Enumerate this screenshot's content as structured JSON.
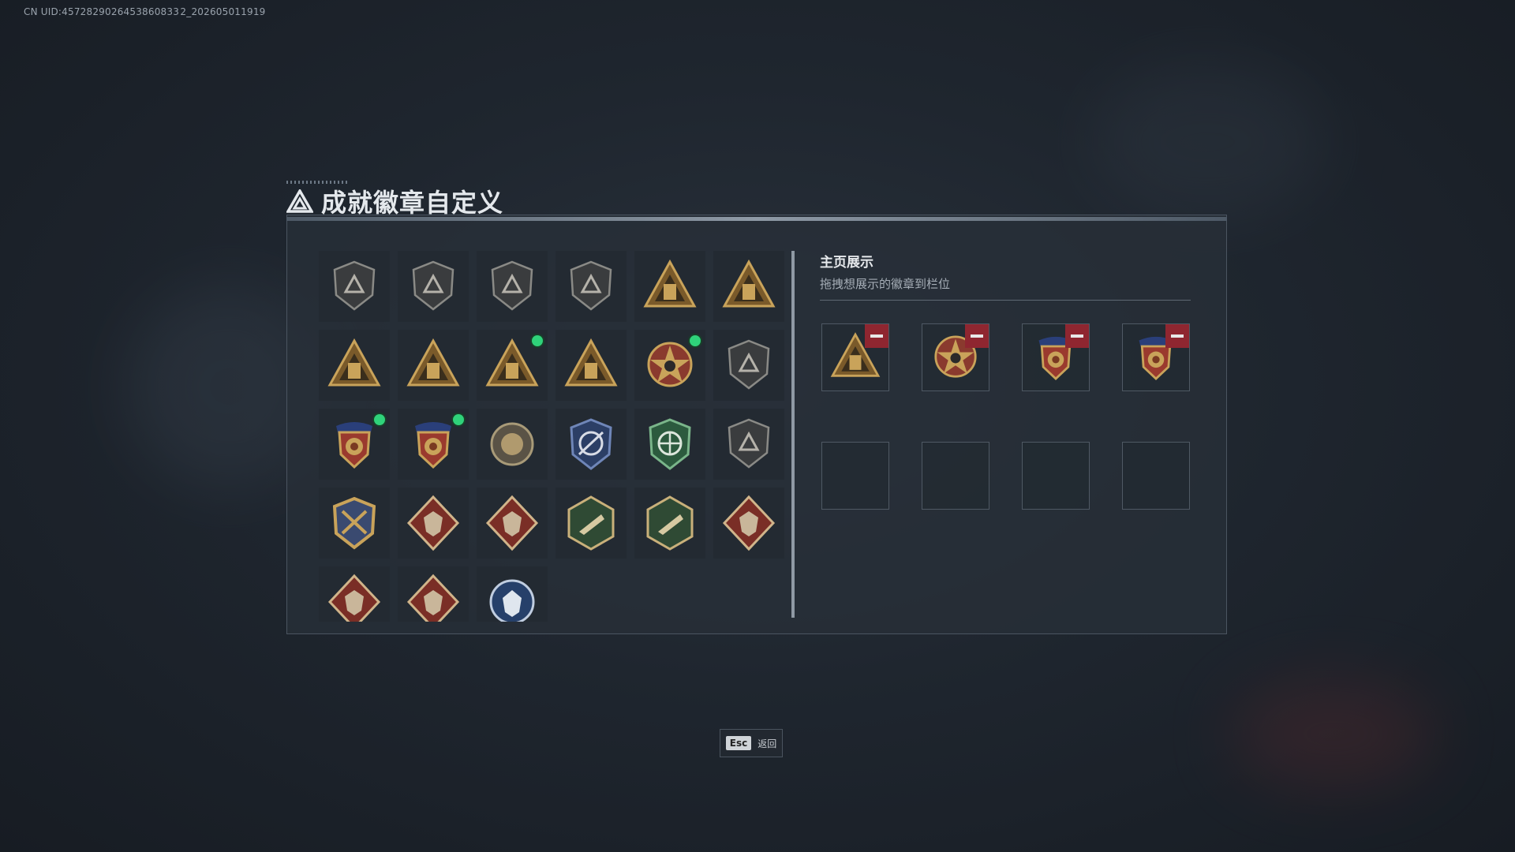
{
  "uid_text": "CN UID:4572829026453860833 2_202605011919",
  "title": "成就徽章自定义",
  "right": {
    "title": "主页展示",
    "subtitle": "拖拽想展示的徽章到栏位"
  },
  "esc": {
    "key": "Esc",
    "label": "返回"
  },
  "badges": [
    {
      "icon": "triangle-shield-badge-icon",
      "style": "dark",
      "new": false
    },
    {
      "icon": "helicopter-shield-badge-icon",
      "style": "dark",
      "new": false
    },
    {
      "icon": "diamond-shield-badge-icon",
      "style": "dark",
      "new": false
    },
    {
      "icon": "arrow-shield-badge-icon",
      "style": "dark",
      "new": false
    },
    {
      "icon": "gold-triangle-34-badge-icon",
      "style": "gold",
      "new": false
    },
    {
      "icon": "gold-triangle-55-badge-icon",
      "style": "gold",
      "new": false
    },
    {
      "icon": "gold-triangle-crate-badge-icon",
      "style": "gold",
      "new": false
    },
    {
      "icon": "gold-triangle-1-badge-icon",
      "style": "gold",
      "new": false
    },
    {
      "icon": "gold-triangle-bottle-badge-icon",
      "style": "gold",
      "new": true
    },
    {
      "icon": "gold-triangle-soldiers-badge-icon",
      "style": "gold",
      "new": false
    },
    {
      "icon": "star-skull-badge-icon",
      "style": "star",
      "new": true
    },
    {
      "icon": "dark-crest-badge-icon",
      "style": "dark",
      "new": false
    },
    {
      "icon": "blue-red-crest-badge-icon",
      "style": "crest",
      "new": true
    },
    {
      "icon": "blue-red-crest-2-badge-icon",
      "style": "crest",
      "new": true
    },
    {
      "icon": "round-emblem-badge-icon",
      "style": "round",
      "new": false
    },
    {
      "icon": "blue-target-badge-icon",
      "style": "blue",
      "new": false
    },
    {
      "icon": "green-target-badge-icon",
      "style": "green",
      "new": false
    },
    {
      "icon": "dark-target-badge-icon",
      "style": "dark",
      "new": false
    },
    {
      "icon": "gold-sword-shield-badge-icon",
      "style": "goldshield",
      "new": false
    },
    {
      "icon": "wolf-diamond-badge-icon",
      "style": "wolf",
      "new": false
    },
    {
      "icon": "wolf-diamond-2-badge-icon",
      "style": "wolf",
      "new": false
    },
    {
      "icon": "green-hex-bird-badge-icon",
      "style": "greenhex",
      "new": false
    },
    {
      "icon": "green-hex-hand-badge-icon",
      "style": "greenhex",
      "new": false
    },
    {
      "icon": "dragon-diamond-badge-icon",
      "style": "wolf",
      "new": false
    },
    {
      "icon": "dragon-diamond-2-badge-icon",
      "style": "wolf",
      "new": false
    },
    {
      "icon": "wolf-diamond-3-badge-icon",
      "style": "wolf",
      "new": false
    },
    {
      "icon": "blue-wolf-round-badge-icon",
      "style": "bluewolf",
      "new": false
    }
  ],
  "showcase_slots": [
    {
      "icon": "gold-triangle-bottle-badge-icon",
      "style": "gold",
      "filled": true
    },
    {
      "icon": "star-skull-badge-icon",
      "style": "star",
      "filled": true
    },
    {
      "icon": "blue-red-crest-badge-icon",
      "style": "crest",
      "filled": true
    },
    {
      "icon": "blue-red-crest-2-badge-icon",
      "style": "crest",
      "filled": true
    },
    {
      "icon": "empty-slot",
      "style": "",
      "filled": false
    },
    {
      "icon": "empty-slot",
      "style": "",
      "filled": false
    },
    {
      "icon": "empty-slot",
      "style": "",
      "filled": false
    },
    {
      "icon": "empty-slot",
      "style": "",
      "filled": false
    }
  ],
  "colors": {
    "new_dot": "#2fd27a",
    "remove_button": "#8f2630",
    "gold": "#c9a35a"
  }
}
